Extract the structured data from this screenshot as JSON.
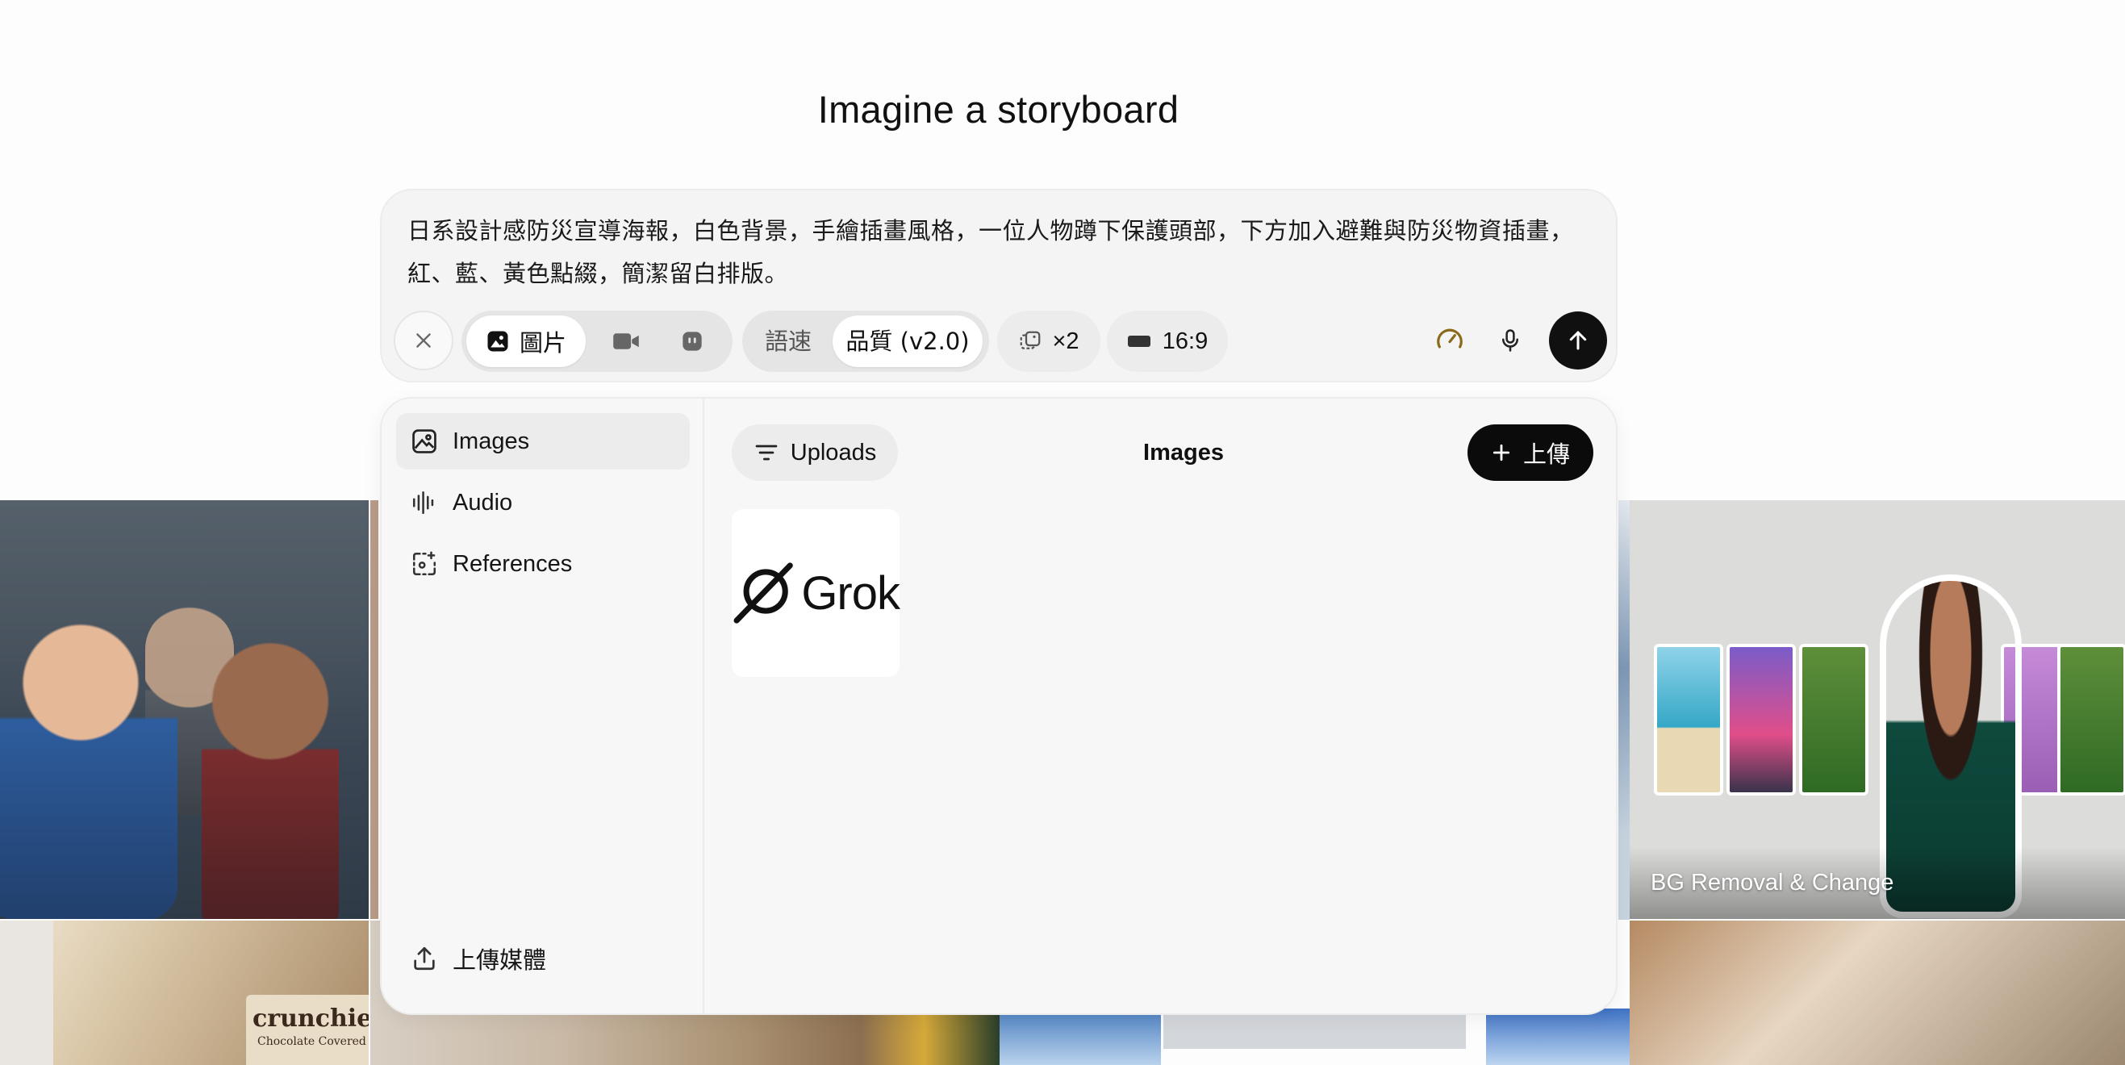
{
  "page": {
    "title": "Imagine a storyboard"
  },
  "prompt": {
    "text": "日系設計感防災宣導海報，白色背景，手繪插畫風格，一位人物蹲下保護頭部，下方加入避難與防災物資插畫，紅、藍、黃色點綴，簡潔留白排版。"
  },
  "toolbar": {
    "close_icon": "close-icon",
    "modes": [
      {
        "label": "圖片",
        "icon": "image-icon",
        "selected": true
      },
      {
        "label": "",
        "icon": "video-icon",
        "selected": false
      },
      {
        "label": "",
        "icon": "bot-icon",
        "selected": false
      }
    ],
    "speed_label": "語速",
    "quality_label": "品質 (v2.0)",
    "count_label": "×2",
    "ratio_label": "16:9",
    "speed_icon": "gauge-icon",
    "mic_icon": "mic-icon",
    "send_icon": "arrow-up-icon",
    "gauge_color": "#8a6a1a"
  },
  "panel": {
    "sidebar": [
      {
        "label": "Images",
        "icon": "image-icon",
        "active": true
      },
      {
        "label": "Audio",
        "icon": "audio-wave-icon",
        "active": false
      },
      {
        "label": "References",
        "icon": "sparkle-frame-icon",
        "active": false
      }
    ],
    "upload_media_label": "上傳媒體",
    "filter_label": "Uploads",
    "title": "Images",
    "upload_button_label": "上傳",
    "items": [
      {
        "logo_text": "Grok"
      }
    ]
  },
  "gallery": {
    "tiles": [
      {
        "label": "BG Removal & Change"
      }
    ],
    "product_text": "crunchies",
    "product_subtext": "Chocolate Covered"
  }
}
